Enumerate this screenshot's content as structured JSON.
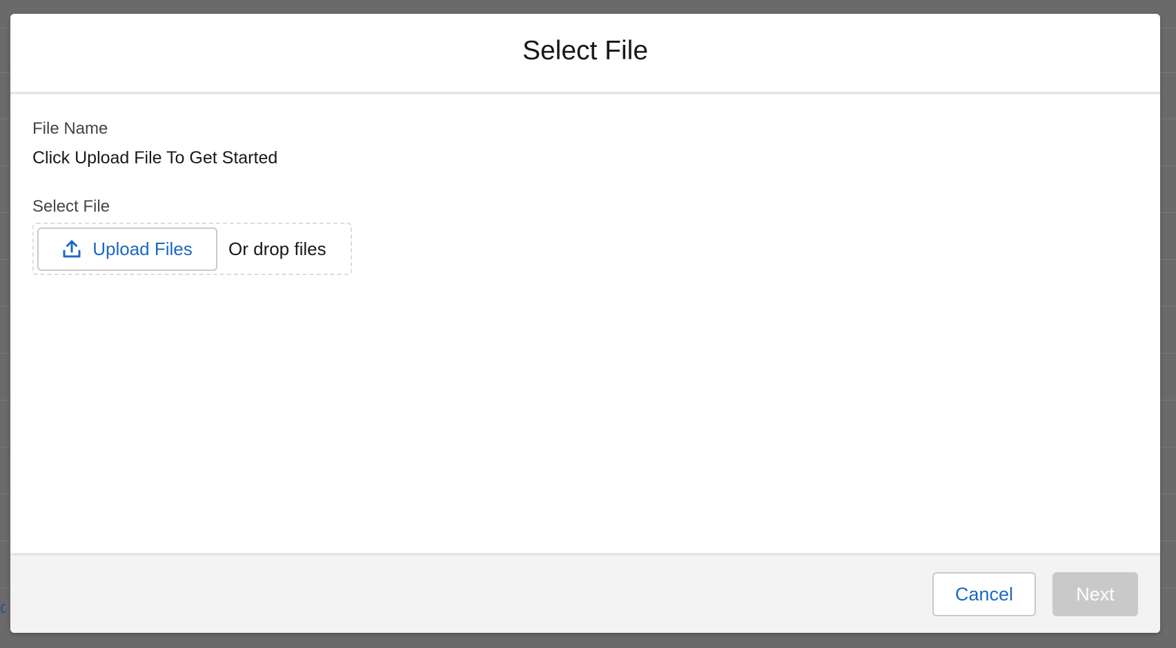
{
  "modal": {
    "title": "Select File",
    "file_name": {
      "label": "File Name",
      "value": "Click Upload File To Get Started"
    },
    "select_file": {
      "label": "Select File",
      "upload_button_label": "Upload Files",
      "upload_icon": "upload-icon",
      "drop_text": "Or drop files"
    },
    "footer": {
      "cancel_label": "Cancel",
      "next_label": "Next",
      "next_disabled": true
    }
  },
  "backdrop": {
    "edge_link_text": "d"
  },
  "colors": {
    "accent": "#1b67c4",
    "disabled_button": "#c9c9c9",
    "footer_background": "#f3f3f3",
    "overlay": "#6b6b6b"
  }
}
